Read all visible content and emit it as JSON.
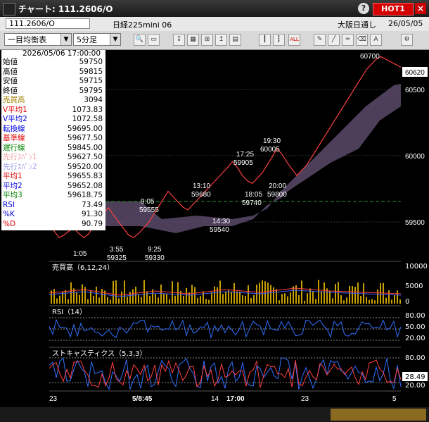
{
  "window": {
    "title": "チャート: 111.2606/O",
    "help_label": "?",
    "hot_label": "HOT1",
    "close_label": "×"
  },
  "info": {
    "symbol": "111.2606/O",
    "name": "日経225mini 06",
    "exchange": "大阪日通し",
    "date": "26/05/05"
  },
  "toolbar": {
    "avg_type": "一目均衡表",
    "interval": "5分足"
  },
  "ohlc": {
    "header": "2026/05/06  17:00:00",
    "rows": [
      {
        "label": "始値",
        "value": "59750",
        "color": "#000000"
      },
      {
        "label": "高値",
        "value": "59815",
        "color": "#000000"
      },
      {
        "label": "安値",
        "value": "59715",
        "color": "#000000"
      },
      {
        "label": "終値",
        "value": "59795",
        "color": "#000000"
      },
      {
        "label": "売買高",
        "value": "3094",
        "color": "#a08000"
      },
      {
        "label": "V平均1",
        "value": "1073.83",
        "color": "#e00000"
      },
      {
        "label": "V平均2",
        "value": "1072.58",
        "color": "#0000e0"
      },
      {
        "label": "転換線",
        "value": "59695.00",
        "color": "#0000e0"
      },
      {
        "label": "基準線",
        "value": "59677.50",
        "color": "#e00000"
      },
      {
        "label": "遅行線",
        "value": "59845.00",
        "color": "#008000"
      },
      {
        "label": "先行ｽﾊﾟﾝ1",
        "value": "59627.50",
        "color": "#f0a0a0"
      },
      {
        "label": "先行ｽﾊﾟﾝ2",
        "value": "59520.00",
        "color": "#a0a0f0"
      },
      {
        "label": "平均1",
        "value": "59655.83",
        "color": "#e00000"
      },
      {
        "label": "平均2",
        "value": "59652.08",
        "color": "#0000e0"
      },
      {
        "label": "平均3",
        "value": "59618.75",
        "color": "#008000"
      },
      {
        "label": "RSI",
        "value": "73.49",
        "color": "#0000e0"
      },
      {
        "label": "%K",
        "value": "91.30",
        "color": "#0000e0"
      },
      {
        "label": "%D",
        "value": "90.79",
        "color": "#e00000"
      }
    ]
  },
  "price_axis": {
    "ticks": [
      "60500",
      "60000",
      "59500"
    ],
    "current": "60620"
  },
  "annotations": [
    {
      "time": "1:05",
      "price": "",
      "x": 0,
      "y": 0
    },
    {
      "time": "3:55",
      "price": "59325"
    },
    {
      "time": "9:05",
      "price": "59555"
    },
    {
      "time": "9:25",
      "price": "59330"
    },
    {
      "time": "13:10",
      "price": "59680"
    },
    {
      "time": "14:30",
      "price": "59540"
    },
    {
      "time": "17:25",
      "price": "59905"
    },
    {
      "time": "18:05",
      "price": "59740"
    },
    {
      "time": "19:30",
      "price": "60005"
    },
    {
      "time": "20:00",
      "price": "59800"
    },
    {
      "time": "",
      "price": "60700"
    }
  ],
  "volume_panel": {
    "label": "売買高（6,12,24）",
    "ticks": [
      "10000",
      "5000",
      "0"
    ]
  },
  "rsi_panel": {
    "label": "RSI（14）",
    "ticks": [
      "80.00",
      "50.00",
      "20.00"
    ]
  },
  "stoch_panel": {
    "label": "ストキャスティクス（5,3,3）",
    "ticks": [
      "80.00",
      "28.49",
      "20.00"
    ]
  },
  "time_axis": {
    "labels": [
      "23",
      "5/8:45",
      "14",
      "17:00",
      "23",
      "5"
    ]
  },
  "chart_data": {
    "type": "line",
    "title": "",
    "xlabel": "",
    "ylabel": "",
    "ylim": [
      59150,
      60750
    ],
    "series": [
      {
        "name": "終値",
        "values": [
          59420,
          59380,
          59330,
          59350,
          59380,
          59400,
          59360,
          59330,
          59360,
          59420,
          59480,
          59520,
          59555,
          59500,
          59450,
          59400,
          59350,
          59330,
          59360,
          59400,
          59440,
          59500,
          59560,
          59620,
          59680,
          59640,
          59600,
          59560,
          59540,
          59580,
          59620,
          59660,
          59700,
          59740,
          59780,
          59820,
          59860,
          59905,
          59860,
          59800,
          59760,
          59740,
          59780,
          59820,
          59880,
          59940,
          60005,
          59960,
          59900,
          59850,
          59800,
          59840,
          59880,
          59940,
          60000,
          60060,
          60120,
          60180,
          60240,
          60300,
          60360,
          60420,
          60480,
          60540,
          60600,
          60640,
          60680,
          60700,
          60680,
          60660,
          60640,
          60620
        ]
      }
    ]
  }
}
